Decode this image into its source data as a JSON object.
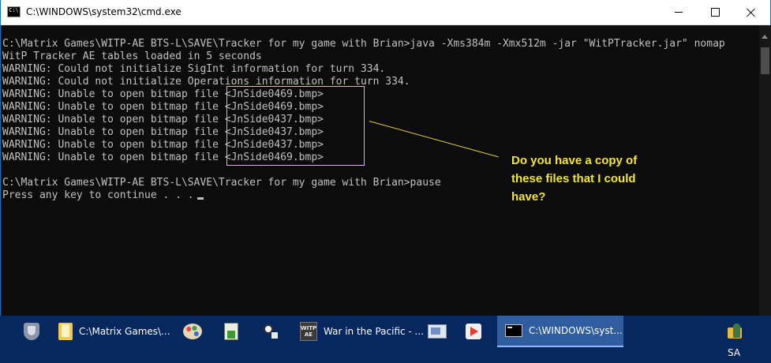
{
  "window": {
    "title": "C:\\WINDOWS\\system32\\cmd.exe",
    "icon": "cmd-icon",
    "controls": [
      "minimize-icon",
      "maximize-icon",
      "close-icon"
    ]
  },
  "console": {
    "lines": [
      "C:\\Matrix Games\\WITP-AE BTS-L\\SAVE\\Tracker for my game with Brian>java -Xms384m -Xmx512m -jar \"WitPTracker.jar\" nomap",
      "WitP Tracker AE tables loaded in 5 seconds",
      "WARNING: Could not initialize SigInt information for turn 334.",
      "WARNING: Could not initialize Operations information for turn 334.",
      "WARNING: Unable to open bitmap file <JnSide0469.bmp>",
      "WARNING: Unable to open bitmap file <JnSide0469.bmp>",
      "WARNING: Unable to open bitmap file <JnSide0437.bmp>",
      "WARNING: Unable to open bitmap file <JnSide0437.bmp>",
      "WARNING: Unable to open bitmap file <JnSide0437.bmp>",
      "WARNING: Unable to open bitmap file <JnSide0469.bmp>",
      "",
      "C:\\Matrix Games\\WITP-AE BTS-L\\SAVE\\Tracker for my game with Brian>pause",
      "Press any key to continue . . ."
    ]
  },
  "annotation": {
    "lines": [
      "Do you have a copy of",
      "these files that I could",
      "have?"
    ],
    "color": "#f3e62f"
  },
  "taskbar": {
    "items": [
      {
        "icon": "shield-icon",
        "label": ""
      },
      {
        "icon": "folder-icon",
        "label": "C:\\Matrix Games\\..."
      },
      {
        "icon": "palette-icon",
        "label": ""
      },
      {
        "icon": "notepad-icon",
        "label": ""
      },
      {
        "icon": "people-search-icon",
        "label": ""
      },
      {
        "icon": "witp-ae-icon",
        "label": "War in the Pacific - ...",
        "icon_text": [
          "WITP",
          "AE"
        ]
      },
      {
        "icon": "image-gallery-icon",
        "label": ""
      },
      {
        "icon": "media-player-icon",
        "label": ""
      },
      {
        "icon": "cmd-icon",
        "label": "C:\\WINDOWS\\syst...",
        "active": true
      }
    ],
    "user": {
      "icon": "user-folder-icon",
      "label": "SA"
    },
    "accent": "#2f5da0"
  }
}
